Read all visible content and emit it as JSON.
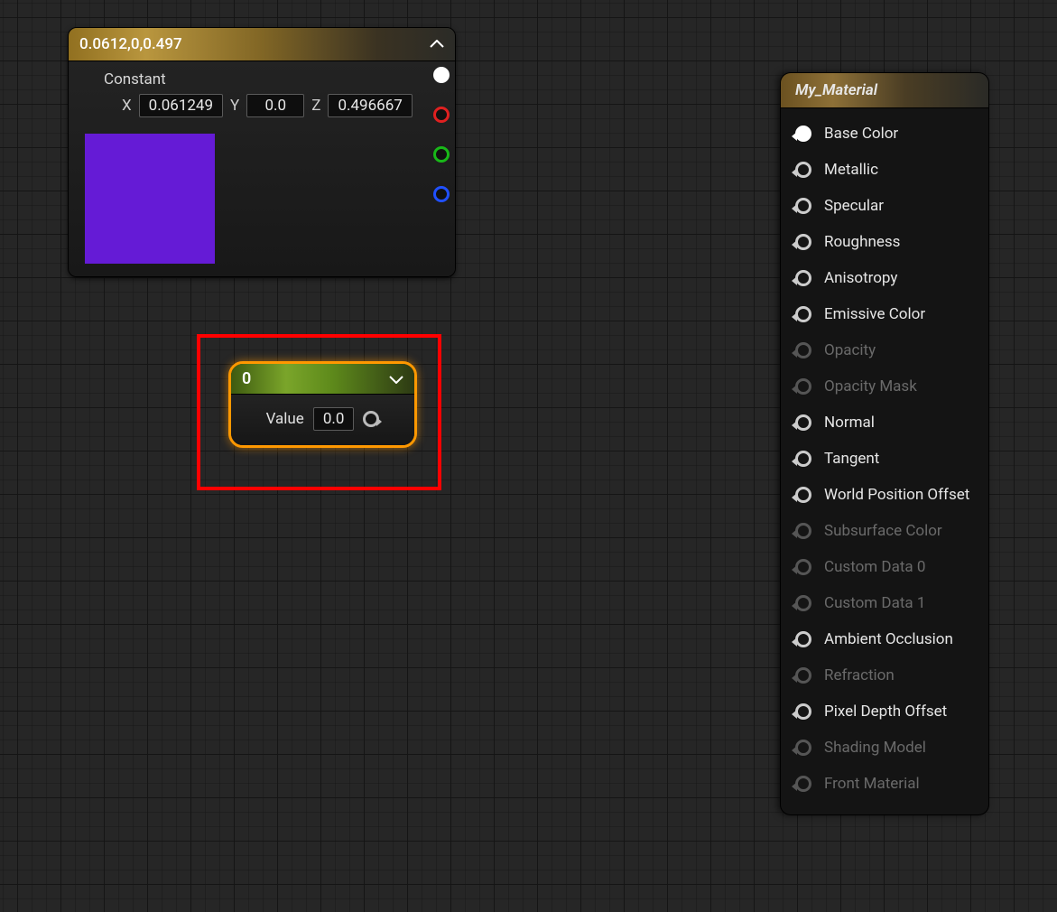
{
  "vec_node": {
    "title": "0.0612,0,0.497",
    "label": "Constant",
    "x_label": "X",
    "x_value": "0.061249",
    "y_label": "Y",
    "y_value": "0.0",
    "z_label": "Z",
    "z_value": "0.496667",
    "swatch_color": "#651bd6"
  },
  "scalar_node": {
    "title": "0",
    "value_label": "Value",
    "value": "0.0"
  },
  "material_node": {
    "title": "My_Material",
    "inputs": [
      {
        "label": "Base Color",
        "enabled": true,
        "connected": true
      },
      {
        "label": "Metallic",
        "enabled": true,
        "connected": false
      },
      {
        "label": "Specular",
        "enabled": true,
        "connected": false
      },
      {
        "label": "Roughness",
        "enabled": true,
        "connected": false
      },
      {
        "label": "Anisotropy",
        "enabled": true,
        "connected": false
      },
      {
        "label": "Emissive Color",
        "enabled": true,
        "connected": false
      },
      {
        "label": "Opacity",
        "enabled": false,
        "connected": false
      },
      {
        "label": "Opacity Mask",
        "enabled": false,
        "connected": false
      },
      {
        "label": "Normal",
        "enabled": true,
        "connected": false
      },
      {
        "label": "Tangent",
        "enabled": true,
        "connected": false
      },
      {
        "label": "World Position Offset",
        "enabled": true,
        "connected": false
      },
      {
        "label": "Subsurface Color",
        "enabled": false,
        "connected": false
      },
      {
        "label": "Custom Data 0",
        "enabled": false,
        "connected": false
      },
      {
        "label": "Custom Data 1",
        "enabled": false,
        "connected": false
      },
      {
        "label": "Ambient Occlusion",
        "enabled": true,
        "connected": false
      },
      {
        "label": "Refraction",
        "enabled": false,
        "connected": false
      },
      {
        "label": "Pixel Depth Offset",
        "enabled": true,
        "connected": false
      },
      {
        "label": "Shading Model",
        "enabled": false,
        "connected": false
      },
      {
        "label": "Front Material",
        "enabled": false,
        "connected": false
      }
    ]
  }
}
